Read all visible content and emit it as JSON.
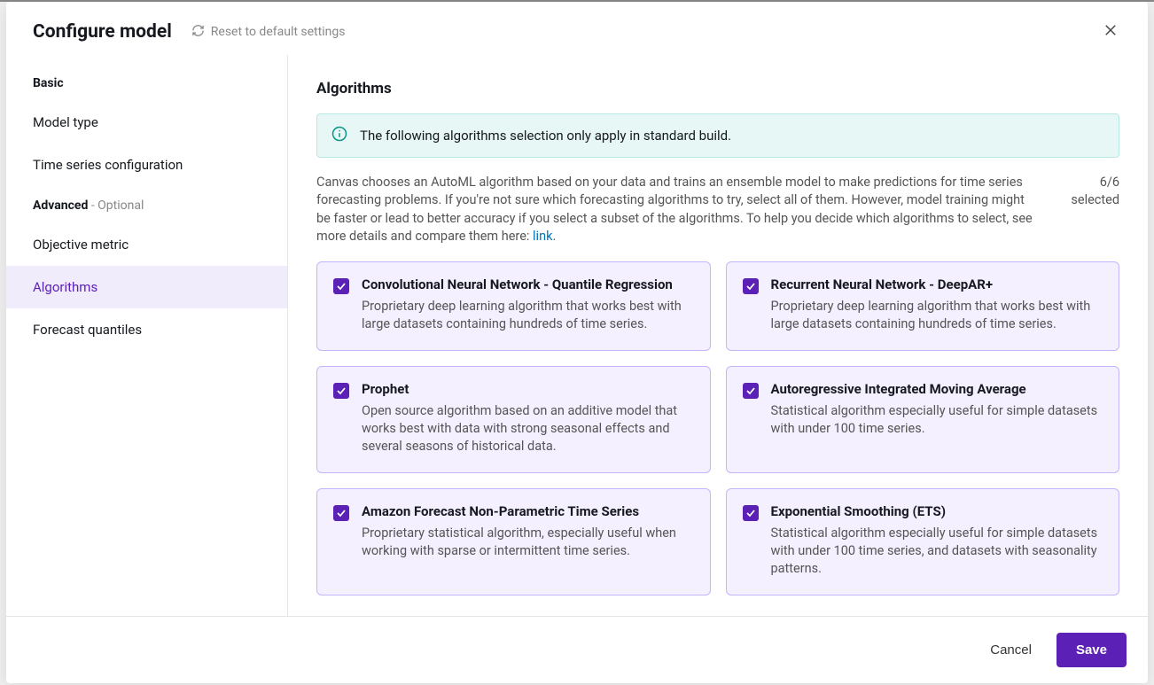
{
  "header": {
    "title": "Configure model",
    "reset_label": "Reset to default settings"
  },
  "sidebar": {
    "groups": [
      {
        "label": "Basic",
        "optional": "",
        "items": [
          "Model type",
          "Time series configuration"
        ]
      },
      {
        "label": "Advanced",
        "optional": " - Optional",
        "items": [
          "Objective metric",
          "Algorithms",
          "Forecast quantiles"
        ]
      }
    ],
    "active": "Algorithms"
  },
  "content": {
    "section_title": "Algorithms",
    "info_text": "The following algorithms selection only apply in standard build.",
    "description_pre": "Canvas chooses an AutoML algorithm based on your data and trains an ensemble model to make predictions for time series forecasting problems. If you're not sure which forecasting algorithms to try, select all of them. However, model training might be faster or lead to better accuracy if you select a subset of the algorithms. To help you decide which algorithms to select, see more details and compare them here: ",
    "description_link_text": "link",
    "description_post": ".",
    "selected_count_top": "6/6",
    "selected_count_bottom": "selected",
    "algorithms": [
      {
        "name": "Convolutional Neural Network - Quantile Regression",
        "desc": "Proprietary deep learning algorithm that works best with large datasets containing hundreds of time series."
      },
      {
        "name": "Recurrent Neural Network - DeepAR+",
        "desc": "Proprietary deep learning algorithm that works best with large datasets containing hundreds of time series."
      },
      {
        "name": "Prophet",
        "desc": "Open source algorithm based on an additive model that works best with data with strong seasonal effects and several seasons of historical data."
      },
      {
        "name": "Autoregressive Integrated Moving Average",
        "desc": "Statistical algorithm especially useful for simple datasets with under 100 time series."
      },
      {
        "name": "Amazon Forecast Non-Parametric Time Series",
        "desc": "Proprietary statistical algorithm, especially useful when working with sparse or intermittent time series."
      },
      {
        "name": "Exponential Smoothing (ETS)",
        "desc": "Statistical algorithm especially useful for simple datasets with under 100 time series, and datasets with seasonality patterns."
      }
    ]
  },
  "footer": {
    "cancel": "Cancel",
    "save": "Save"
  }
}
